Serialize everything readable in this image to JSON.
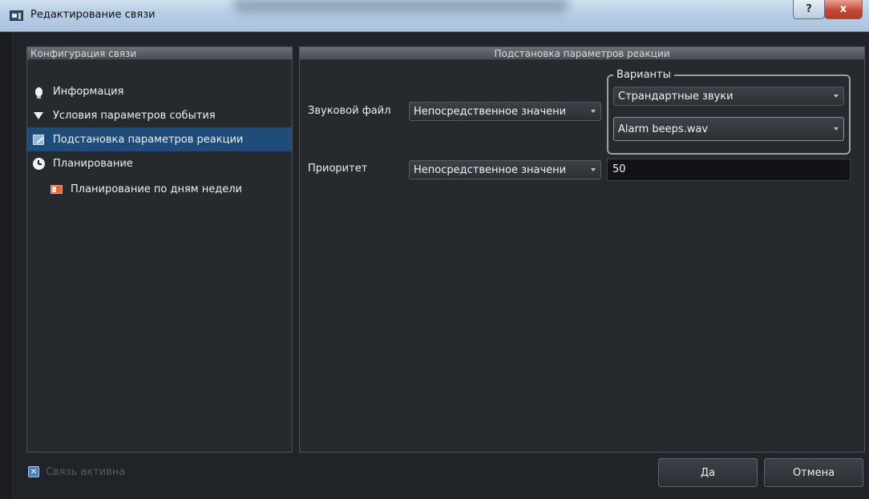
{
  "window": {
    "title": "Редактирование связи",
    "help_symbol": "?",
    "close_symbol": "x"
  },
  "left_panel": {
    "header": "Конфигурация связи",
    "items": [
      {
        "label": "Информация",
        "icon": "lightbulb-icon"
      },
      {
        "label": "Условия параметров события",
        "icon": "filter-icon"
      },
      {
        "label": "Подстановка параметров реакции",
        "icon": "edit-icon",
        "selected": true
      },
      {
        "label": "Планирование",
        "icon": "clock-icon"
      },
      {
        "label": "Планирование по дням недели",
        "icon": "calendar-icon",
        "indent": 1
      }
    ]
  },
  "right_panel": {
    "header": "Подстановка параметров реакции",
    "sound": {
      "label": "Звуковой файл",
      "mode_value": "Непосредственное значени",
      "variants_title": "Варианты",
      "category_value": "Страндартные звуки",
      "file_value": "Alarm beeps.wav"
    },
    "priority": {
      "label": "Приоритет",
      "mode_value": "Непосредственное значени",
      "value": "50"
    }
  },
  "footer": {
    "active_checkbox_label": "Связь активна",
    "active_checked": true,
    "ok_label": "Да",
    "cancel_label": "Отмена"
  },
  "colors": {
    "selection": "#1f4c78",
    "background": "#202327"
  }
}
